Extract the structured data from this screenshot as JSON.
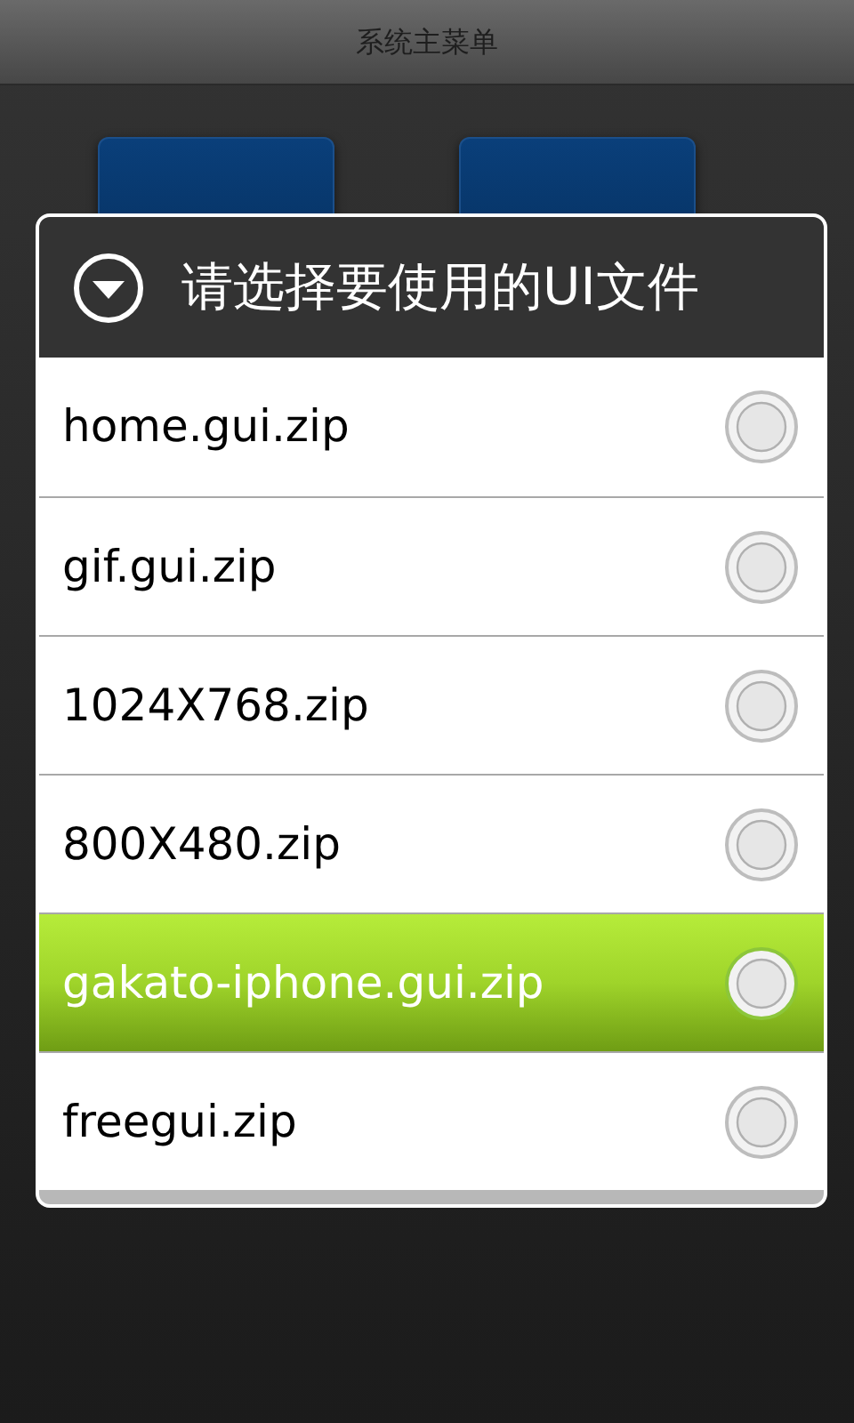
{
  "title_bar": {
    "title": "系统主菜单"
  },
  "menu_buttons": [
    {
      "kind": "tile"
    },
    {
      "kind": "tile"
    }
  ],
  "dialog": {
    "title": "请选择要使用的UI文件",
    "items": [
      {
        "label": "home.gui.zip",
        "highlighted": false,
        "checked": false
      },
      {
        "label": "gif.gui.zip",
        "highlighted": false,
        "checked": false
      },
      {
        "label": "1024X768.zip",
        "highlighted": false,
        "checked": false
      },
      {
        "label": "800X480.zip",
        "highlighted": false,
        "checked": false
      },
      {
        "label": "gakato-iphone.gui.zip",
        "highlighted": true,
        "checked": false
      },
      {
        "label": "freegui.zip",
        "highlighted": false,
        "checked": false
      }
    ]
  }
}
